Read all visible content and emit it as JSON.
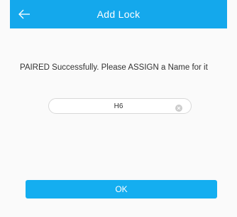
{
  "header": {
    "title": "Add Lock",
    "back_icon": "arrow-left-icon",
    "background": "#14a8ec"
  },
  "message": "PAIRED Successfully. Please ASSIGN a Name for it",
  "name_field": {
    "value": "H6",
    "clear_icon": "clear-circle-icon"
  },
  "ok_button": {
    "label": "OK",
    "background": "#14aef0"
  }
}
